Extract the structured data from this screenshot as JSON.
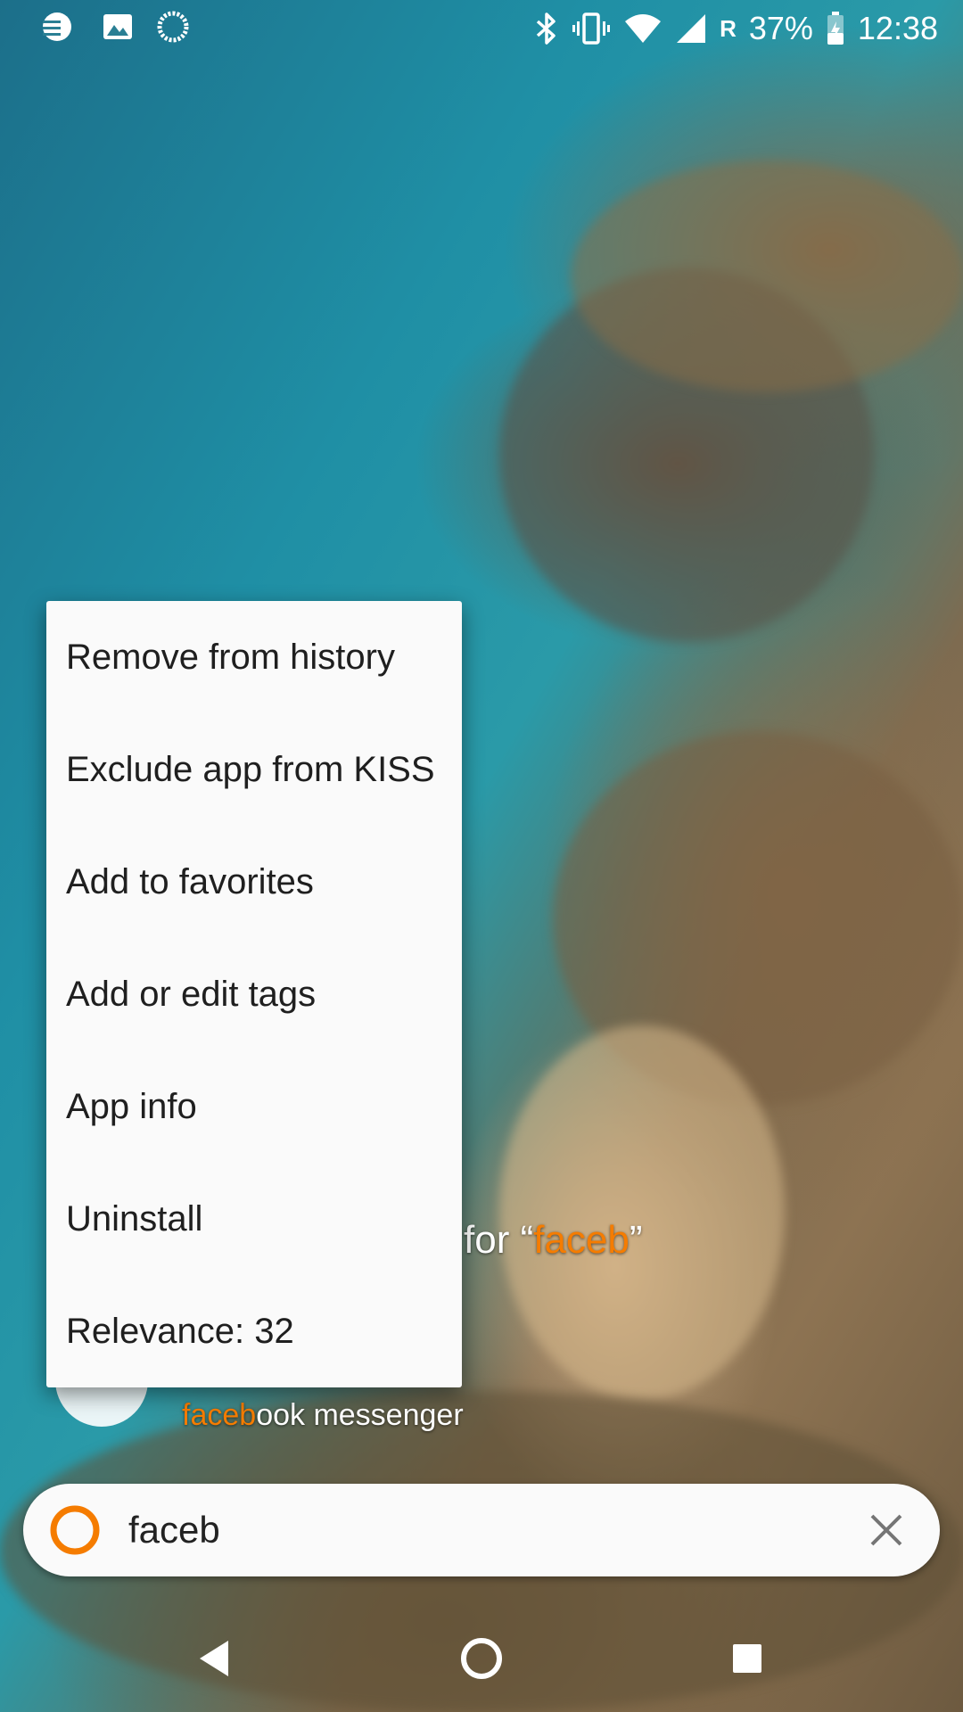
{
  "status_bar": {
    "icons_left": [
      "notification-icon",
      "gallery-icon",
      "loading-icon"
    ],
    "icons_right": [
      "bluetooth-icon",
      "vibrate-icon",
      "wifi-icon",
      "signal-icon"
    ],
    "roaming": "R",
    "battery": "37%",
    "time": "12:38"
  },
  "background_result": {
    "search_prefix": "for “",
    "search_term": "faceb",
    "search_suffix": "”",
    "app_highlight": "faceb",
    "app_rest": "ook messenger",
    "app_icon": "messenger-icon"
  },
  "context_menu": {
    "items": [
      "Remove from history",
      "Exclude app from KISS",
      "Add to favorites",
      "Add or edit tags",
      "App info",
      "Uninstall",
      "Relevance: 32"
    ]
  },
  "search": {
    "value": "faceb",
    "logo_icon": "kiss-logo-icon",
    "clear_icon": "close-icon"
  },
  "nav": {
    "back": "back-icon",
    "home": "home-icon",
    "recents": "recents-icon"
  },
  "colors": {
    "accent": "#f57c00",
    "menu_background": "#fafafa",
    "menu_text": "#1f1f1f"
  }
}
